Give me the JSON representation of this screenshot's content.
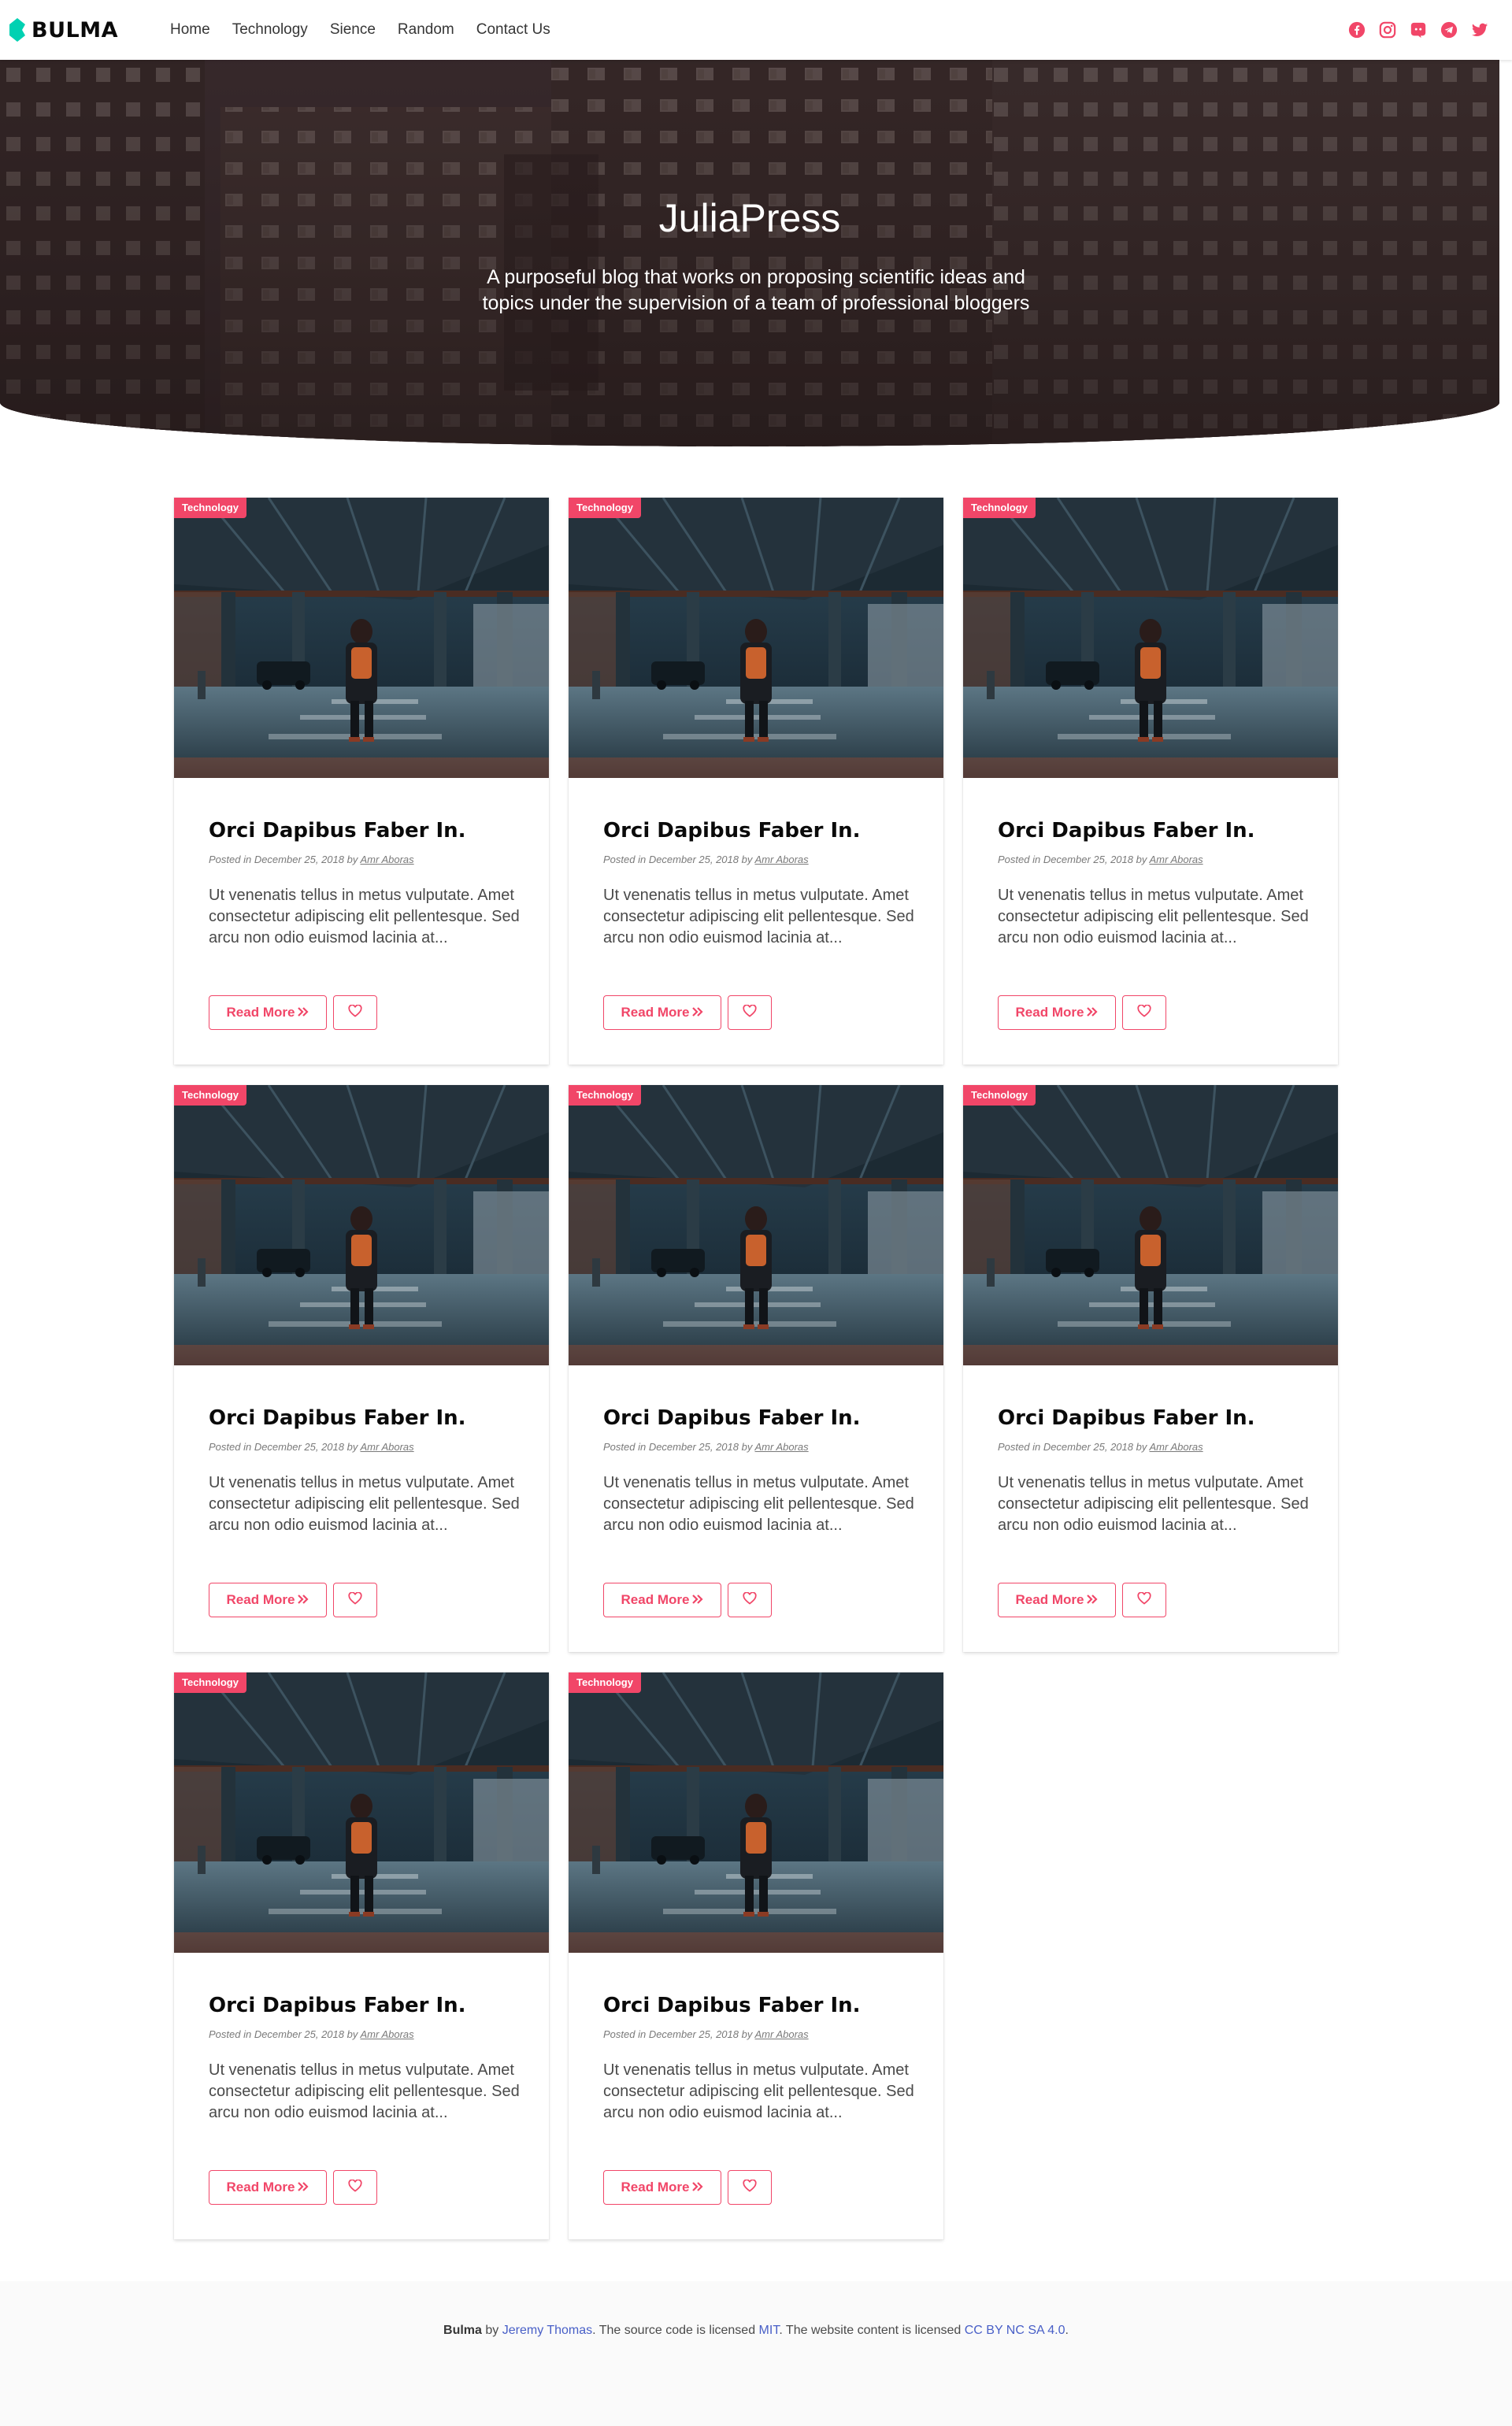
{
  "navbar": {
    "brand": "BULMA",
    "items": [
      {
        "label": "Home"
      },
      {
        "label": "Technology"
      },
      {
        "label": "Sience"
      },
      {
        "label": "Random"
      },
      {
        "label": "Contact Us"
      }
    ],
    "socials": [
      "facebook-icon",
      "instagram-icon",
      "discord-icon",
      "telegram-icon",
      "twitter-icon"
    ]
  },
  "hero": {
    "title": "JuliaPress",
    "subtitle": "A purposeful blog that works on proposing scientific ideas and topics under the supervision of a team of professional bloggers"
  },
  "colors": {
    "accent": "#f14668",
    "brand": "#00d1b2",
    "link": "#485fc7"
  },
  "cards": [
    {
      "tag": "Technology",
      "title": "Orci Dapibus Faber In.",
      "meta_prefix": "Posted in December 25, 2018 by",
      "author": "Amr Aboras",
      "excerpt": "Ut venenatis tellus in metus vulputate. Amet consectetur adipiscing elit pellentesque. Sed arcu non odio euismod lacinia at...",
      "read_more": "Read More"
    },
    {
      "tag": "Technology",
      "title": "Orci Dapibus Faber In.",
      "meta_prefix": "Posted in December 25, 2018 by",
      "author": "Amr Aboras",
      "excerpt": "Ut venenatis tellus in metus vulputate. Amet consectetur adipiscing elit pellentesque. Sed arcu non odio euismod lacinia at...",
      "read_more": "Read More"
    },
    {
      "tag": "Technology",
      "title": "Orci Dapibus Faber In.",
      "meta_prefix": "Posted in December 25, 2018 by",
      "author": "Amr Aboras",
      "excerpt": "Ut venenatis tellus in metus vulputate. Amet consectetur adipiscing elit pellentesque. Sed arcu non odio euismod lacinia at...",
      "read_more": "Read More"
    },
    {
      "tag": "Technology",
      "title": "Orci Dapibus Faber In.",
      "meta_prefix": "Posted in December 25, 2018 by",
      "author": "Amr Aboras",
      "excerpt": "Ut venenatis tellus in metus vulputate. Amet consectetur adipiscing elit pellentesque. Sed arcu non odio euismod lacinia at...",
      "read_more": "Read More"
    },
    {
      "tag": "Technology",
      "title": "Orci Dapibus Faber In.",
      "meta_prefix": "Posted in December 25, 2018 by",
      "author": "Amr Aboras",
      "excerpt": "Ut venenatis tellus in metus vulputate. Amet consectetur adipiscing elit pellentesque. Sed arcu non odio euismod lacinia at...",
      "read_more": "Read More"
    },
    {
      "tag": "Technology",
      "title": "Orci Dapibus Faber In.",
      "meta_prefix": "Posted in December 25, 2018 by",
      "author": "Amr Aboras",
      "excerpt": "Ut venenatis tellus in metus vulputate. Amet consectetur adipiscing elit pellentesque. Sed arcu non odio euismod lacinia at...",
      "read_more": "Read More"
    },
    {
      "tag": "Technology",
      "title": "Orci Dapibus Faber In.",
      "meta_prefix": "Posted in December 25, 2018 by",
      "author": "Amr Aboras",
      "excerpt": "Ut venenatis tellus in metus vulputate. Amet consectetur adipiscing elit pellentesque. Sed arcu non odio euismod lacinia at...",
      "read_more": "Read More"
    },
    {
      "tag": "Technology",
      "title": "Orci Dapibus Faber In.",
      "meta_prefix": "Posted in December 25, 2018 by",
      "author": "Amr Aboras",
      "excerpt": "Ut venenatis tellus in metus vulputate. Amet consectetur adipiscing elit pellentesque. Sed arcu non odio euismod lacinia at...",
      "read_more": "Read More"
    }
  ],
  "footer": {
    "brand": "Bulma",
    "by": "by",
    "author": "Jeremy Thomas",
    "code_license_text": ". The source code is licensed",
    "code_license": "MIT",
    "content_license_text": ". The website content is licensed",
    "content_license": "CC BY NC SA 4.0",
    "end": "."
  }
}
